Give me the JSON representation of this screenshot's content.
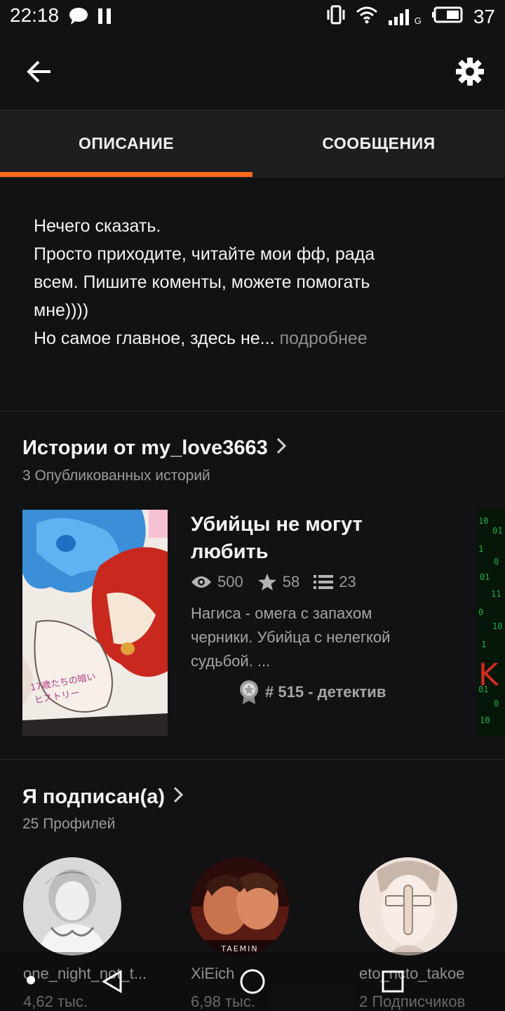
{
  "status_bar": {
    "time": "22:18",
    "battery": "37",
    "network": "G"
  },
  "header": {
    "back_icon": "arrow-left-icon",
    "settings_icon": "gear-icon"
  },
  "tabs": [
    {
      "label": "ОПИСАНИЕ",
      "active": true
    },
    {
      "label": "СООБЩЕНИЯ",
      "active": false
    }
  ],
  "accent_color": "#ff6a1a",
  "description": {
    "lines": [
      "Нечего сказать.",
      "Просто приходите, читайте мои фф, рада",
      "всем. Пишите коменты, можете помогать",
      "мне))))",
      "Но самое главное, здесь не..."
    ],
    "more": " подробнее"
  },
  "stories_section": {
    "title": "Истории от my_love3663",
    "subtitle": "3 Опубликованных историй",
    "story": {
      "title": "Убийцы не могут любить",
      "reads": "500",
      "votes": "58",
      "parts": "23",
      "description": "Нагиса - омега с запахом черники. Убийца с нелегкой судьбой. ...",
      "rank": "# 515 - детектив",
      "cover_caption": "17歳たちの暗いヒストリー"
    }
  },
  "following_section": {
    "title": "Я подписан(а)",
    "subtitle": "25 Профилей",
    "profiles": [
      {
        "name": "one_night_not_t...",
        "followers": "4,62 тыс."
      },
      {
        "name": "XiEich",
        "followers": "6,98 тыс.",
        "avatar_caption": "TAEMIN"
      },
      {
        "name": "eto_ncto_takoe",
        "followers": "2 Подписчиков"
      }
    ]
  },
  "nav_bar": {
    "back": "triangle-back-icon",
    "home": "circle-home-icon",
    "recents": "square-recents-icon"
  }
}
